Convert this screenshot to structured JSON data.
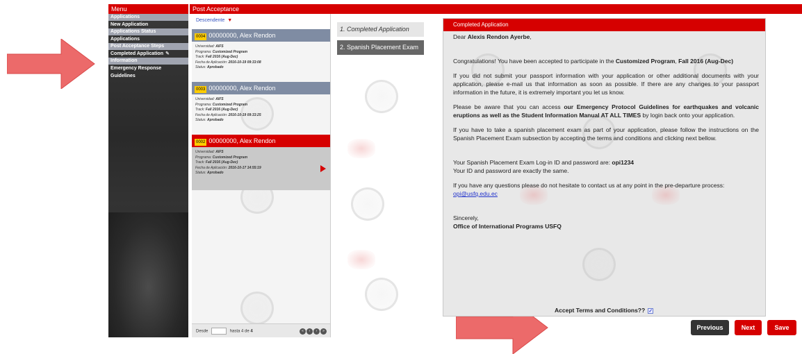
{
  "menu": {
    "title": "Menu",
    "sections": [
      {
        "label": "Applications",
        "items": [
          "New Application"
        ]
      },
      {
        "label": "Applications Status",
        "items": [
          "Applications"
        ]
      },
      {
        "label": "Post Acceptance Steps",
        "items": [
          "Completed Application"
        ]
      },
      {
        "label": "Information",
        "items": [
          "Emergency Response Guidelines"
        ]
      }
    ]
  },
  "header": {
    "title": "Post Acceptance"
  },
  "list": {
    "sort_label": "Descendente",
    "records": [
      {
        "num": "0004",
        "name": "00000000, Alex Rendon",
        "universidad_label": "Universidad:",
        "universidad": "AIFS",
        "programa_label": "Programa:",
        "programa": "Customized Program",
        "track_label": "Track:",
        "track": "Fall 2016 (Aug-Dec)",
        "fecha_label": "Fecha de Aplicación:",
        "fecha": "2016-10-19 09:33:08",
        "status_label": "Status:",
        "status": "Aprobado"
      },
      {
        "num": "0003",
        "name": "00000000, Alex Rendon",
        "universidad_label": "Universidad:",
        "universidad": "AIFS",
        "programa_label": "Programa:",
        "programa": "Customized Program",
        "track_label": "Track:",
        "track": "Fall 2016 (Aug-Dec)",
        "fecha_label": "Fecha de Aplicación:",
        "fecha": "2016-10-19 09:33:25",
        "status_label": "Status:",
        "status": "Aprobado"
      },
      {
        "num": "0002",
        "name": "00000000, Alex Rendon",
        "universidad_label": "Universidad:",
        "universidad": "AIFS",
        "programa_label": "Programa:",
        "programa": "Customized Program",
        "track_label": "Track:",
        "track": "Fall 2016 (Aug-Dec)",
        "fecha_label": "Fecha de Aplicación:",
        "fecha": "2016-10-17 14:55:19",
        "status_label": "Status:",
        "status": "Aprobado"
      }
    ],
    "pager": {
      "desde_label": "Desde",
      "hasta_text": "hasta 4 de",
      "total": "4"
    }
  },
  "steps": [
    {
      "label": "1. Completed Application"
    },
    {
      "label": "2. Spanish Placement Exam"
    }
  ],
  "content": {
    "title": "Completed Application",
    "greeting_prefix": "Dear ",
    "greeting_name": "Alexis Rendon Ayerbe",
    "greeting_suffix": ",",
    "p1_prefix": "Congratulations! You have been accepted to participate in the ",
    "p1_program": "Customized Program",
    "p1_mid": ", ",
    "p1_term": "Fall 2016 (Aug-Dec)",
    "p2": "If you did not submit your passport information with your application or other additional documents with your application, please e-mail us that information as soon as possible. If there are any changes to your passport information in the future, it is extremely important you let us know.",
    "p3_prefix": "Please be aware that you can access ",
    "p3_bold": "our Emergency Protocol Guidelines for earthquakes and volcanic eruptions as well as the Student Information Manual AT ALL TIMES",
    "p3_suffix": " by login back onto your application.",
    "p4": "If you have to take a spanish placement exam as part of your application, please follow the instructions on the Spanish Placement Exam subsection by accepting the terms and conditions and clicking next bellow.",
    "p5_prefix": "Your Spanish Placement Exam Log-in ID and password are: ",
    "p5_id": "opi1234",
    "p5_line2": "Your ID and password are exactly the same.",
    "p6": "If you have any questions please do not hesitate to contact us at any point in the pre-departure process:",
    "p6_email": "opi@usfq.edu.ec",
    "closing": "Sincerely,",
    "signature": "Office of International Programs USFQ",
    "accept_label": "Accept Terms and Conditions??"
  },
  "buttons": {
    "previous": "Previous",
    "next": "Next",
    "save": "Save"
  },
  "colors": {
    "accent": "#d60000",
    "menu_section": "#a0a4b0",
    "card_gray": "#7f8ca3",
    "arrow": "#ec6a6a"
  }
}
